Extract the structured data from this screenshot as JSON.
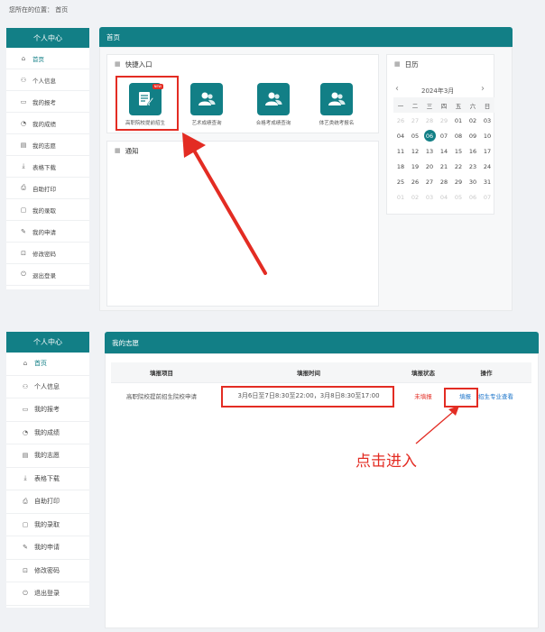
{
  "location": "您所在的位置： 首页",
  "panel1": {
    "sidebar": {
      "header": "个人中心",
      "items": [
        {
          "icon": "home-icon",
          "glyph": "⌂",
          "label": "首页"
        },
        {
          "icon": "user-icon",
          "glyph": "⚇",
          "label": "个人信息"
        },
        {
          "icon": "application-icon",
          "glyph": "▭",
          "label": "我的报考"
        },
        {
          "icon": "score-icon",
          "glyph": "◔",
          "label": "我的成绩"
        },
        {
          "icon": "document-icon",
          "glyph": "▤",
          "label": "我的志愿"
        },
        {
          "icon": "download-icon",
          "glyph": "⤓",
          "label": "表格下载"
        },
        {
          "icon": "print-icon",
          "glyph": "⎙",
          "label": "自助打印"
        },
        {
          "icon": "admission-icon",
          "glyph": "▢",
          "label": "我的录取"
        },
        {
          "icon": "edit-icon",
          "glyph": "✎",
          "label": "我的申请"
        },
        {
          "icon": "lock-icon",
          "glyph": "⊡",
          "label": "修改密码"
        },
        {
          "icon": "logout-icon",
          "glyph": "⏻",
          "label": "退出登录"
        }
      ]
    },
    "main_title": "首页",
    "quick_entry": {
      "title": "快捷入口",
      "items": [
        "高职院校提前招生",
        "艺术成绩查询",
        "合格考成绩查询",
        "体艺类统考报名"
      ],
      "badge": "NEW"
    },
    "notice": {
      "title": "通知"
    },
    "calendar": {
      "title": "日历",
      "prev": "‹",
      "next": "›",
      "month": "2024年3月",
      "weekdays": [
        "一",
        "二",
        "三",
        "四",
        "五",
        "六",
        "日"
      ],
      "days": [
        [
          "26",
          "dim"
        ],
        [
          "27",
          "dim"
        ],
        [
          "28",
          "dim"
        ],
        [
          "29",
          "dim"
        ],
        [
          "01",
          ""
        ],
        [
          "02",
          ""
        ],
        [
          "03",
          ""
        ],
        [
          "04",
          ""
        ],
        [
          "05",
          ""
        ],
        [
          "06",
          "today"
        ],
        [
          "07",
          ""
        ],
        [
          "08",
          ""
        ],
        [
          "09",
          ""
        ],
        [
          "10",
          ""
        ],
        [
          "11",
          ""
        ],
        [
          "12",
          ""
        ],
        [
          "13",
          ""
        ],
        [
          "14",
          ""
        ],
        [
          "15",
          ""
        ],
        [
          "16",
          ""
        ],
        [
          "17",
          ""
        ],
        [
          "18",
          ""
        ],
        [
          "19",
          ""
        ],
        [
          "20",
          ""
        ],
        [
          "21",
          ""
        ],
        [
          "22",
          ""
        ],
        [
          "23",
          ""
        ],
        [
          "24",
          ""
        ],
        [
          "25",
          ""
        ],
        [
          "26",
          ""
        ],
        [
          "27",
          ""
        ],
        [
          "28",
          ""
        ],
        [
          "29",
          ""
        ],
        [
          "30",
          ""
        ],
        [
          "31",
          ""
        ],
        [
          "01",
          "dim"
        ],
        [
          "02",
          "dim"
        ],
        [
          "03",
          "dim"
        ],
        [
          "04",
          "dim"
        ],
        [
          "05",
          "dim"
        ],
        [
          "06",
          "dim"
        ],
        [
          "07",
          "dim"
        ]
      ]
    }
  },
  "panel2": {
    "main_title": "我的志愿",
    "table": {
      "headers": [
        "填报项目",
        "填报时间",
        "填报状态",
        "操作"
      ],
      "row": {
        "project": "高职院校提前招生院校申请",
        "time": "3月6日至7日8:30至22:00，3月8日8:30至17:00",
        "status": "未填报",
        "action_fill": "填报",
        "action_view": "招生专业查看"
      }
    },
    "annotation": "点击进入"
  },
  "colors": {
    "teal": "#127f86",
    "red": "#e32c23",
    "link": "#1a73c9"
  }
}
